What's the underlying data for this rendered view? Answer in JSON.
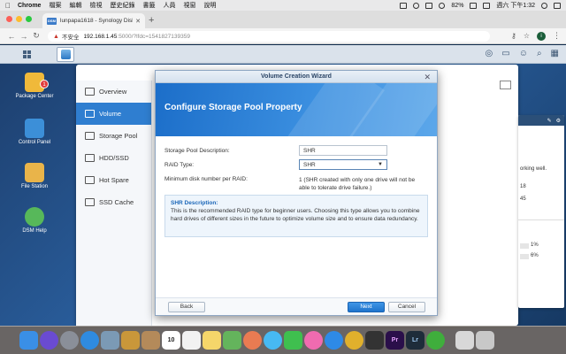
{
  "menubar": {
    "app": "Chrome",
    "items": [
      "檔案",
      "編輯",
      "檢視",
      "歷史紀錄",
      "書籤",
      "人員",
      "視窗",
      "說明"
    ],
    "battery": "82%",
    "clock": "週六 下午1:32"
  },
  "browser": {
    "tab_title": "lunpapa1618 - Synology DiskS",
    "tab_favicon": "DSM",
    "not_secure": "不安全",
    "url_host": "192.168.1.45",
    "url_path": ":5000/?lfdc=1541827139359",
    "profile_initial": "i"
  },
  "desktop_icons": [
    {
      "label": "Package Center",
      "badge": "1",
      "color": "#f0b93a"
    },
    {
      "label": "Control Panel",
      "color": "#3c8fd8"
    },
    {
      "label": "File Station",
      "color": "#e9b44a"
    },
    {
      "label": "DSM Help",
      "color": "#57b85a"
    }
  ],
  "storage_manager": {
    "sidebar": [
      {
        "label": "Overview",
        "active": false
      },
      {
        "label": "Volume",
        "active": true
      },
      {
        "label": "Storage Pool",
        "active": false
      },
      {
        "label": "HDD/SSD",
        "active": false
      },
      {
        "label": "Hot Spare",
        "active": false
      },
      {
        "label": "SSD Cache",
        "active": false
      }
    ]
  },
  "widget": {
    "text_working": "orking well.",
    "text_a": "18",
    "text_b": "45",
    "pct1": "1%",
    "pct2": "6%"
  },
  "wizard": {
    "title": "Volume Creation Wizard",
    "heading": "Configure Storage Pool Property",
    "fields": {
      "description_label": "Storage Pool Description:",
      "description_value": "SHR",
      "raid_label": "RAID Type:",
      "raid_value": "SHR",
      "min_disk_label": "Minimum disk number per RAID:",
      "min_disk_value": "1 (SHR created with only one drive will not be able to tolerate drive failure.)"
    },
    "desc_title": "SHR Description:",
    "desc_text": "This is the recommended RAID type for beginner users. Choosing this type allows you to combine hard drives of different sizes in the future to optimize volume size and to ensure data redundancy.",
    "buttons": {
      "back": "Back",
      "next": "Next",
      "cancel": "Cancel"
    }
  },
  "dock": {
    "calendar_day": "10",
    "apps": [
      {
        "name": "Finder",
        "color": "#3a8fe6"
      },
      {
        "name": "Siri",
        "color": "#6a4bd1"
      },
      {
        "name": "Launchpad",
        "color": "#8a8f99"
      },
      {
        "name": "Safari",
        "color": "#2f8be0"
      },
      {
        "name": "Preview",
        "color": "#7b9ab5"
      },
      {
        "name": "Notes",
        "color": "#c9973a"
      },
      {
        "name": "Contacts",
        "color": "#b48a5a"
      },
      {
        "name": "Calendar",
        "color": "#ffffff"
      },
      {
        "name": "Reminders",
        "color": "#f2f2f2"
      },
      {
        "name": "Notes2",
        "color": "#f5d66a"
      },
      {
        "name": "Maps",
        "color": "#64b45c"
      },
      {
        "name": "Photos",
        "color": "#e97b52"
      },
      {
        "name": "Messages",
        "color": "#47b9f2"
      },
      {
        "name": "FaceTime",
        "color": "#3fbf4f"
      },
      {
        "name": "iTunes",
        "color": "#f06bb0"
      },
      {
        "name": "App Store",
        "color": "#2e8ae6"
      },
      {
        "name": "Chrome",
        "color": "#e0b02c"
      },
      {
        "name": "Final Cut",
        "color": "#333333"
      },
      {
        "name": "Premiere",
        "color": "#2a0f4a"
      },
      {
        "name": "Lightroom",
        "color": "#1e2c3a"
      },
      {
        "name": "Evernote",
        "color": "#3fae3c"
      },
      {
        "name": "Doc",
        "color": "#d8d8d8"
      },
      {
        "name": "Trash",
        "color": "#c8c8c8"
      }
    ]
  }
}
